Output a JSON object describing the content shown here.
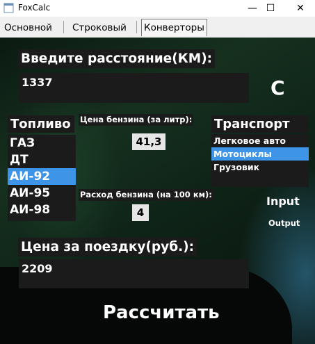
{
  "window": {
    "title": "FoxCalc",
    "minimize": "—",
    "maximize": "☐",
    "close": "✕"
  },
  "tabs": [
    "Основной",
    "Строковый",
    "Конверторы"
  ],
  "distance": {
    "label": "Введите расстояние(КМ):",
    "value": "1337"
  },
  "clear_button": "C",
  "fuel": {
    "label": "Топливо",
    "items": [
      "ГАЗ",
      "ДТ",
      "АИ-92",
      "АИ-95",
      "АИ-98"
    ],
    "selected": 2
  },
  "price": {
    "label": "Цена бензина (за литр):",
    "value": "41,3"
  },
  "consumption": {
    "label": "Расход бензина (на 100 км):",
    "value": "4"
  },
  "transport": {
    "label": "Транспорт",
    "items": [
      "Легковое авто",
      "Мотоциклы",
      "Грузовик"
    ],
    "selected": 1
  },
  "input_button": "Input",
  "output_button": "Output",
  "trip": {
    "label": "Цена за поездку(руб.):",
    "value": "2209"
  },
  "calculate_button": "Рассчитать",
  "colors": {
    "selection": "#3e94e6",
    "panel": "#1b1b1b"
  }
}
